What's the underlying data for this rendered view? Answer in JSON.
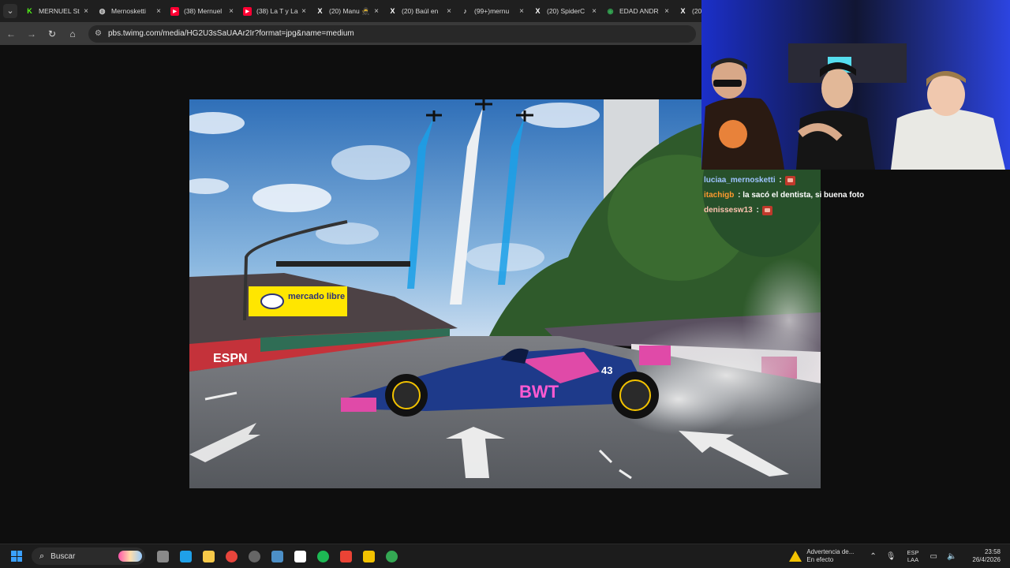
{
  "browser": {
    "tabs": [
      {
        "label": "MERNUEL St",
        "icon": "kick-icon",
        "color": "#53fc18"
      },
      {
        "label": "Mernosketti",
        "icon": "globe-icon",
        "color": "#cccccc"
      },
      {
        "label": "(38) Mernuel",
        "icon": "youtube-icon",
        "color": "#ff0033"
      },
      {
        "label": "(38) La T y La",
        "icon": "youtube-icon",
        "color": "#ff0033"
      },
      {
        "label": "(20) Manu 🥷",
        "icon": "x-icon",
        "color": "#ffffff"
      },
      {
        "label": "(20) Baúl en",
        "icon": "x-icon",
        "color": "#ffffff"
      },
      {
        "label": "(99+)mernu",
        "icon": "tiktok-icon",
        "color": "#ffffff"
      },
      {
        "label": "(20) SpiderC",
        "icon": "x-icon",
        "color": "#ffffff"
      },
      {
        "label": "EDAD ANDR",
        "icon": "chrome-icon",
        "color": "#34a853"
      },
      {
        "label": "(20",
        "icon": "x-icon",
        "color": "#ffffff"
      }
    ],
    "url": "pbs.twimg.com/media/HG2U3sSaUAAr2Ir?format=jpg&name=medium"
  },
  "photo": {
    "banner_text": "mercado libre",
    "sponsor_text": "BWT",
    "car_number": "43",
    "barrier_text": "ESPN",
    "colors": {
      "sky": "#4a86c8",
      "car_blue": "#1e3a8a",
      "car_pink": "#e04aa8",
      "banner_yellow": "#ffd500"
    }
  },
  "chat": {
    "messages": [
      {
        "user": "luciaa_mernosketti",
        "user_color": "#9ec3ff",
        "text": "",
        "emote": true
      },
      {
        "user": "itachigb",
        "user_color": "#ff9a2e",
        "text": "la sacó el dentista, si buena foto",
        "emote": false
      },
      {
        "user": "denissesw13",
        "user_color": "#ffc3b0",
        "text": "",
        "emote": true
      }
    ]
  },
  "taskbar": {
    "search_label": "Buscar",
    "apps": [
      {
        "icon": "file-explorer-icon",
        "color": "#8a8a8a"
      },
      {
        "icon": "edge-icon",
        "color": "#1fa0e8"
      },
      {
        "icon": "folder-icon",
        "color": "#f7c948"
      },
      {
        "icon": "chrome-icon",
        "color": "#e8453c"
      },
      {
        "icon": "obs-icon",
        "color": "#666666"
      },
      {
        "icon": "steam-icon",
        "color": "#4c8fc7"
      },
      {
        "icon": "tiktok-icon",
        "color": "#ffffff"
      },
      {
        "icon": "spotify-icon",
        "color": "#1db954"
      },
      {
        "icon": "maps-icon",
        "color": "#ea4335"
      },
      {
        "icon": "app-icon",
        "color": "#f2c200"
      },
      {
        "icon": "chrome-icon",
        "color": "#34a853"
      }
    ],
    "warning_title": "Advertencia de...",
    "warning_sub": "En efecto",
    "lang_top": "ESP",
    "lang_bottom": "LAA",
    "time": "23:58",
    "date": "26/4/2026"
  }
}
